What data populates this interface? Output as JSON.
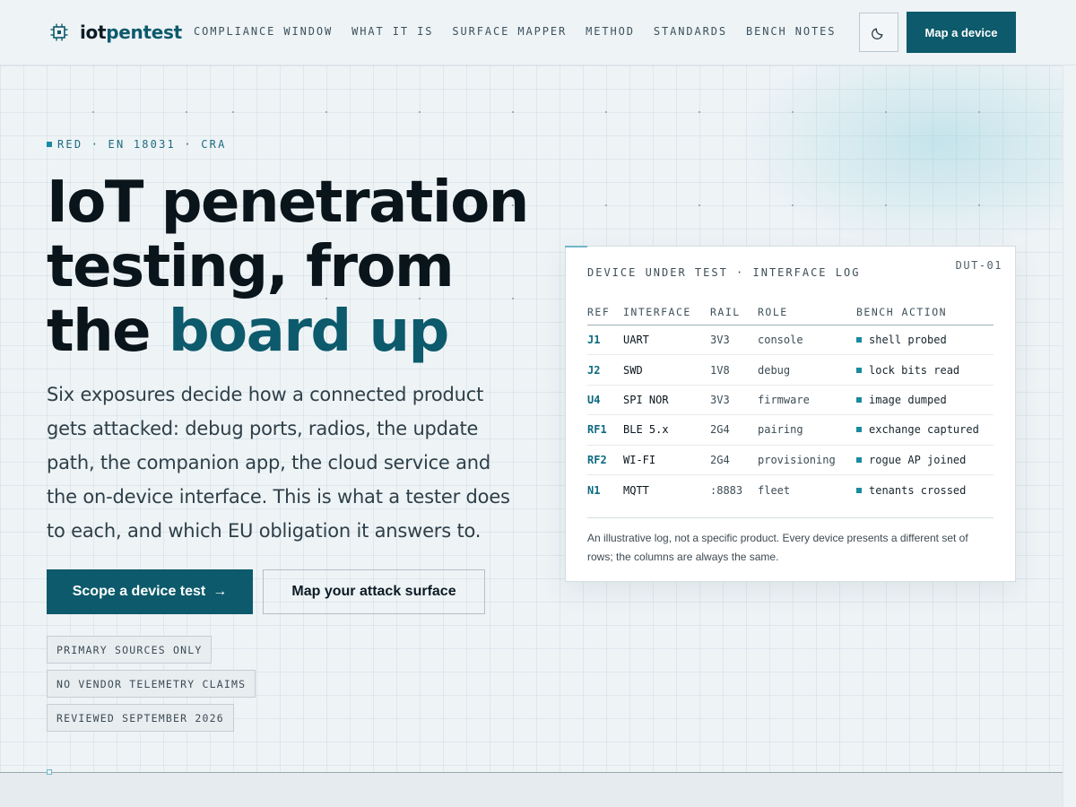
{
  "brand": {
    "name_a": "iot",
    "name_b": "pentest",
    "icon": "chip-icon"
  },
  "nav": {
    "items": [
      {
        "label": "COMPLIANCE WINDOW"
      },
      {
        "label": "WHAT IT IS"
      },
      {
        "label": "SURFACE MAPPER"
      },
      {
        "label": "METHOD"
      },
      {
        "label": "STANDARDS"
      },
      {
        "label": "BENCH NOTES"
      }
    ],
    "theme_icon": "moon-icon",
    "cta_label": "Map a device"
  },
  "hero": {
    "eyebrow": "RED · EN 18031 · CRA",
    "title_line1": "IoT penetration",
    "title_line2": "testing, from",
    "title_line3a": "the ",
    "title_line3b": "board up",
    "lede": "Six exposures decide how a connected product gets attacked: debug ports, radios, the update path, the companion app, the cloud service and the on-device interface. This is what a tester does to each, and which EU obligation it answers to.",
    "primary_label": "Scope a device test",
    "primary_arrow": "→",
    "secondary_label": "Map your attack surface",
    "chips": [
      "PRIMARY SOURCES ONLY",
      "NO VENDOR TELEMETRY CLAIMS",
      "REVIEWED SEPTEMBER 2026"
    ]
  },
  "card": {
    "title": "DEVICE UNDER TEST · INTERFACE LOG",
    "id": "DUT-01",
    "columns": [
      "REF",
      "INTERFACE",
      "RAIL",
      "ROLE",
      "BENCH ACTION"
    ],
    "rows": [
      {
        "ref": "J1",
        "interface": "UART",
        "rail": "3V3",
        "role": "console",
        "action": "shell probed"
      },
      {
        "ref": "J2",
        "interface": "SWD",
        "rail": "1V8",
        "role": "debug",
        "action": "lock bits read"
      },
      {
        "ref": "U4",
        "interface": "SPI NOR",
        "rail": "3V3",
        "role": "firmware",
        "action": "image dumped"
      },
      {
        "ref": "RF1",
        "interface": "BLE 5.x",
        "rail": "2G4",
        "role": "pairing",
        "action": "exchange captured"
      },
      {
        "ref": "RF2",
        "interface": "WI-FI",
        "rail": "2G4",
        "role": "provisioning",
        "action": "rogue AP joined"
      },
      {
        "ref": "N1",
        "interface": "MQTT",
        "rail": ":8883",
        "role": "fleet",
        "action": "tenants crossed"
      }
    ],
    "footnote": "An illustrative log, not a specific product. Every device presents a different set of rows; the columns are always the same."
  },
  "colors": {
    "accent": "#0c5a6b",
    "accent_light": "#1a8aa3",
    "background": "#eef3f6"
  }
}
